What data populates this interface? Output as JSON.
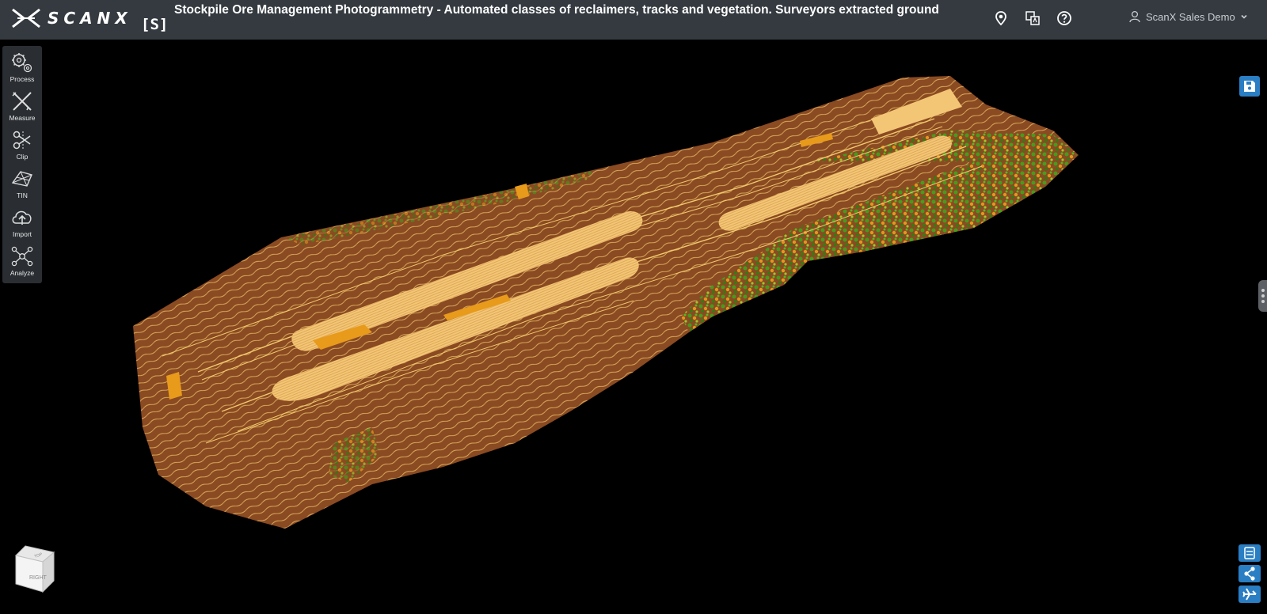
{
  "app": {
    "logo_text": "SCANX",
    "tag": "[S]",
    "title": "Stockpile Ore Management Photogrammetry - Automated classes of reclaimers, tracks and vegetation. Surveyors extracted ground"
  },
  "header_icons": [
    "location-pin-icon",
    "translate-icon",
    "help-icon"
  ],
  "user": {
    "name": "ScanX Sales Demo"
  },
  "toolbar": {
    "items": [
      {
        "label": "Process",
        "icon": "gears-icon"
      },
      {
        "label": "Measure",
        "icon": "ruler-icon"
      },
      {
        "label": "Clip",
        "icon": "scissors-icon"
      },
      {
        "label": "TIN",
        "icon": "tin-mesh-icon"
      },
      {
        "label": "Import",
        "icon": "cloud-upload-icon"
      },
      {
        "label": "Analyze",
        "icon": "network-icon"
      }
    ]
  },
  "viewport": {
    "cube_labels": {
      "right": "RIGHT",
      "top": "TOP"
    },
    "colors": {
      "ground": "#8a4a22",
      "contour": "#f2c96b",
      "reclaimer": "#f3c675",
      "track": "#e89a1b",
      "vegetation": "#3fa11a"
    }
  },
  "right_buttons": [
    "save-icon",
    "layers-icon",
    "share-icon",
    "fly-mode-icon"
  ]
}
